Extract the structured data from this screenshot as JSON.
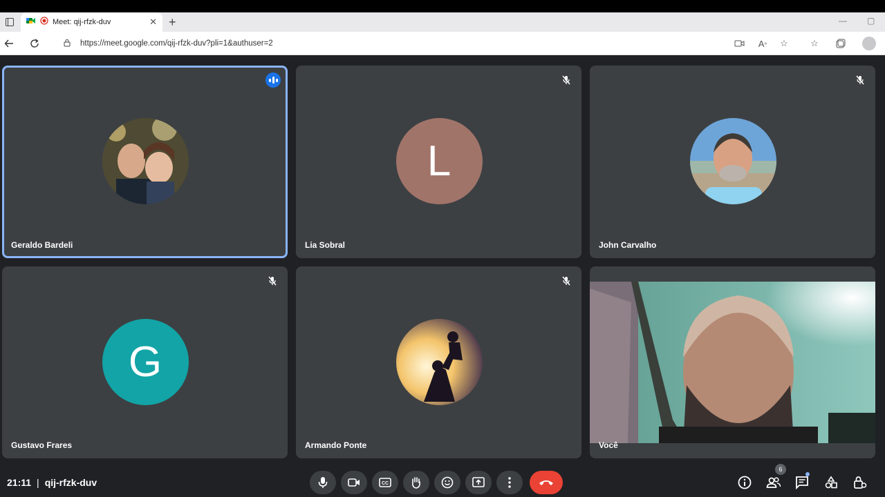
{
  "browser": {
    "tab_title": "Meet: qij-rfzk-duv",
    "url": "https://meet.google.com/qij-rfzk-duv?pli=1&authuser=2",
    "new_tab_label": "+",
    "close_tab_label": "✕"
  },
  "participants": [
    {
      "name": "Geraldo Bardeli",
      "avatar_type": "photo",
      "muted": false,
      "speaking": true
    },
    {
      "name": "Lia Sobral",
      "avatar_type": "letter",
      "letter": "L",
      "avatar_color": "#a1746a",
      "muted": true,
      "speaking": false
    },
    {
      "name": "John Carvalho",
      "avatar_type": "photo",
      "muted": true,
      "speaking": false
    },
    {
      "name": "Gustavo Frares",
      "avatar_type": "letter",
      "letter": "G",
      "avatar_color": "#12a4a6",
      "muted": true,
      "speaking": false
    },
    {
      "name": "Armando Ponte",
      "avatar_type": "photo",
      "muted": true,
      "speaking": false
    },
    {
      "name": "Você",
      "avatar_type": "video",
      "muted": false,
      "speaking": false
    }
  ],
  "footer": {
    "time": "21:11",
    "separator": "|",
    "meeting_code": "qij-rfzk-duv",
    "participant_count": "6"
  },
  "colors": {
    "background": "#202124",
    "tile": "#3c4043",
    "speaking_border": "#8ab4f8",
    "hangup": "#ea4335",
    "accent": "#1a73e8"
  },
  "icons": {
    "controls": [
      "microphone-icon",
      "camera-icon",
      "captions-icon",
      "raise-hand-icon",
      "emoji-icon",
      "present-icon",
      "more-options-icon",
      "hang-up-icon"
    ],
    "right": [
      "info-icon",
      "people-icon",
      "chat-icon",
      "activities-icon",
      "host-controls-icon"
    ]
  }
}
